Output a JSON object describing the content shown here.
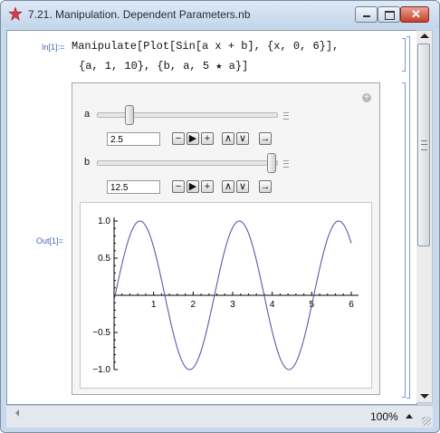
{
  "window": {
    "title": "7.21. Manipulation. Dependent Parameters.nb",
    "icon": "mathematica-star-icon"
  },
  "cell": {
    "in_label": "In[1]:=",
    "out_label": "Out[1]=",
    "code_line1": "Manipulate[Plot[Sin[a x + b], {x, 0, 6}],",
    "code_line2": "{a, 1, 10}, {b, a, 5 ★ a}]"
  },
  "manipulate": {
    "controls": [
      {
        "label": "a",
        "value": "2.5",
        "slider_fraction": 0.167
      },
      {
        "label": "b",
        "value": "12.5",
        "slider_fraction": 1.0
      }
    ],
    "buttons": {
      "minus": "−",
      "play": "▶",
      "plus": "+",
      "faster": "∧",
      "slower": "∨",
      "step": "→"
    }
  },
  "status": {
    "zoom": "100%"
  },
  "chart_data": {
    "type": "line",
    "function": "Sin[2.5 x + 12.5]",
    "xlim": [
      0,
      6
    ],
    "ylim": [
      -1.0,
      1.0
    ],
    "x_ticks": [
      "1",
      "2",
      "3",
      "4",
      "5",
      "6"
    ],
    "y_ticks": [
      "1.0",
      "0.5",
      "−0.5",
      "−1.0"
    ],
    "series": [
      {
        "color": "#4b4ba0"
      }
    ]
  },
  "colors": {
    "curve": "#4b4ba0",
    "label_blue": "#4a68b8",
    "bracket": "#7e9bd6"
  }
}
